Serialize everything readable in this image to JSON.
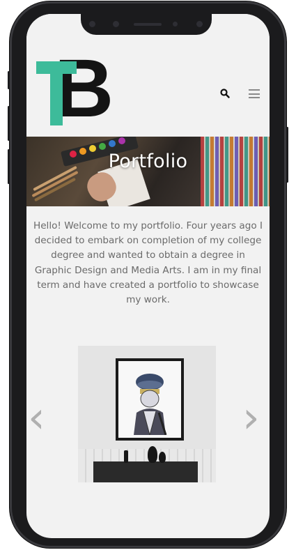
{
  "header": {
    "logo_text": "TB",
    "icons": [
      "search-icon",
      "menu-icon"
    ]
  },
  "hero": {
    "title": "Portfolio"
  },
  "intro": {
    "lines": [
      "Hello! Welcome to my portfolio. Four years ago I",
      "decided to embark on completion of my college",
      "degree and wanted to obtain a degree in",
      "Graphic Design and Media Arts. I am in my final",
      "term and have created a portfolio to showcase",
      "my work."
    ]
  },
  "carousel": {
    "prev_icon": "chevron-left-icon",
    "next_icon": "chevron-right-icon",
    "prev_glyph": "‹",
    "next_glyph": "›"
  },
  "colors": {
    "brand_teal": "#3dbb9a",
    "logo_black": "#141414",
    "text_gray": "#6a6a6a",
    "screen_bg": "#f2f2f2",
    "phone_frame": "#1b1b1d"
  }
}
